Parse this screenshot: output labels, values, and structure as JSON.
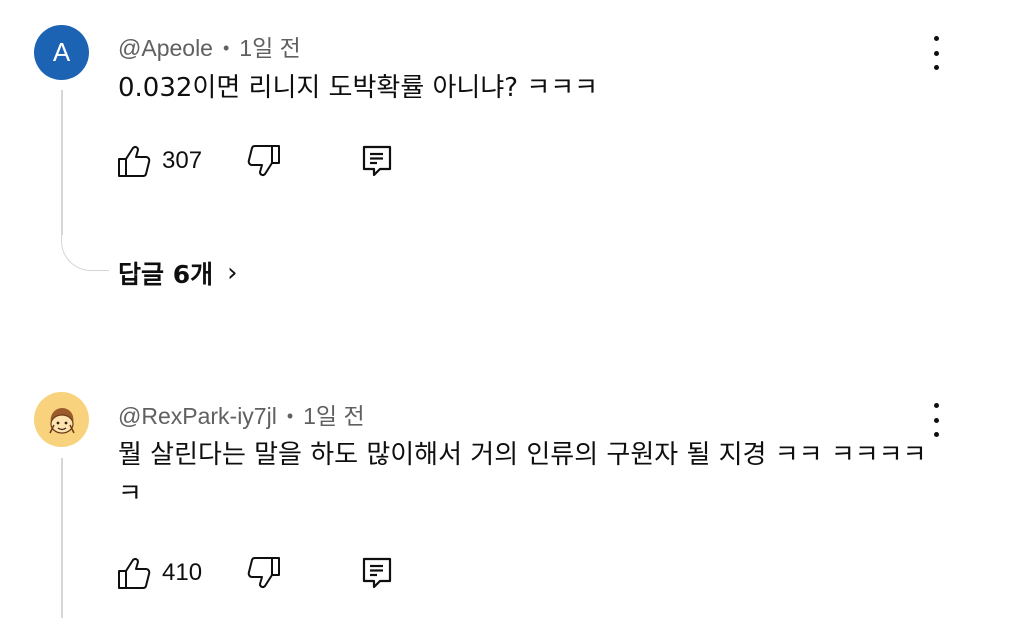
{
  "comments": [
    {
      "avatar_letter": "A",
      "avatar_color": "#1d63b4",
      "author": "@Apeole",
      "separator": "•",
      "time": "1일 전",
      "text": "0.032이면 리니지 도박확률 아니냐? ㅋㅋㅋ",
      "likes": "307",
      "replies_label": "답글 6개",
      "replies_chevron": "›"
    },
    {
      "avatar_icon": "emoji-avatar",
      "avatar_color": "#f9d27d",
      "author": "@RexPark-iy7jl",
      "separator": "•",
      "time": "1일 전",
      "text": "뭘 살린다는 말을 하도 많이해서 거의 인류의 구원자 될 지경 ㅋㅋ ㅋㅋㅋㅋㅋ",
      "likes": "410"
    }
  ],
  "icons": {
    "like": "thumbs-up-icon",
    "dislike": "thumbs-down-icon",
    "reply": "reply-icon",
    "menu": "more-vert-icon"
  }
}
